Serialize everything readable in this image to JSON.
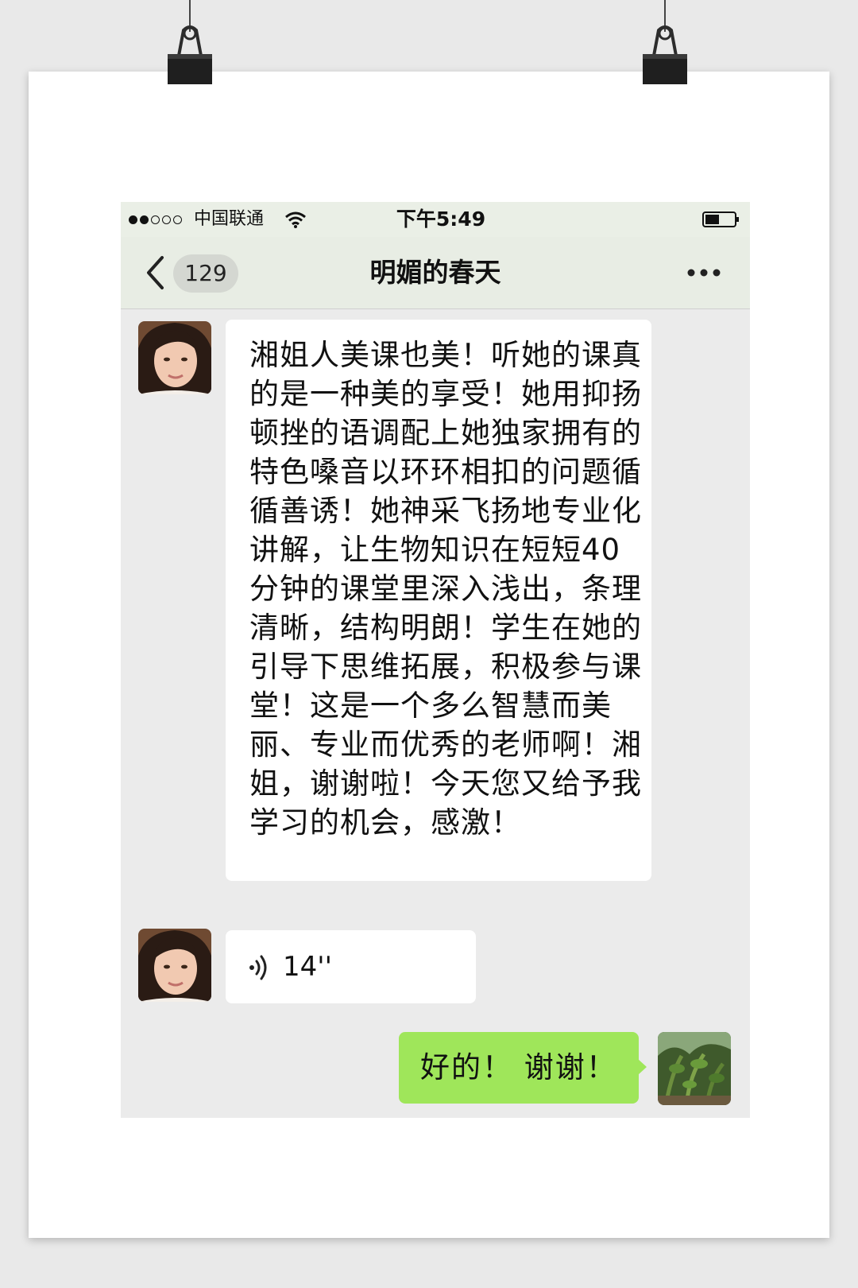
{
  "status_bar": {
    "carrier": "中国联通",
    "time": "下午5:49",
    "signal_bars_filled": 2,
    "signal_bars_total": 5
  },
  "nav": {
    "back_icon": "chevron-left-icon",
    "unread_count": "129",
    "chat_title": "明媚的春天",
    "more_icon": "more-dots-icon"
  },
  "messages": [
    {
      "sender": "other",
      "type": "text",
      "text": "湘姐人美课也美！听她的课真的是一种美的享受！她用抑扬顿挫的语调配上她独家拥有的特色嗓音以环环相扣的问题循循善诱！她神采飞扬地专业化讲解，让生物知识在短短40分钟的课堂里深入浅出，条理清晰，结构明朗！学生在她的引导下思维拓展，积极参与课堂！这是一个多么智慧而美丽、专业而优秀的老师啊！湘姐，谢谢啦！今天您又给予我学习的机会，感激！"
    },
    {
      "sender": "other",
      "type": "voice",
      "duration": "14''"
    },
    {
      "sender": "me",
      "type": "text",
      "text": "好的！ 谢谢！"
    }
  ],
  "colors": {
    "chat_background": "#ebebeb",
    "received_bubble": "#ffffff",
    "sent_bubble": "#9fe65a",
    "navbar": "#e8ede4"
  }
}
